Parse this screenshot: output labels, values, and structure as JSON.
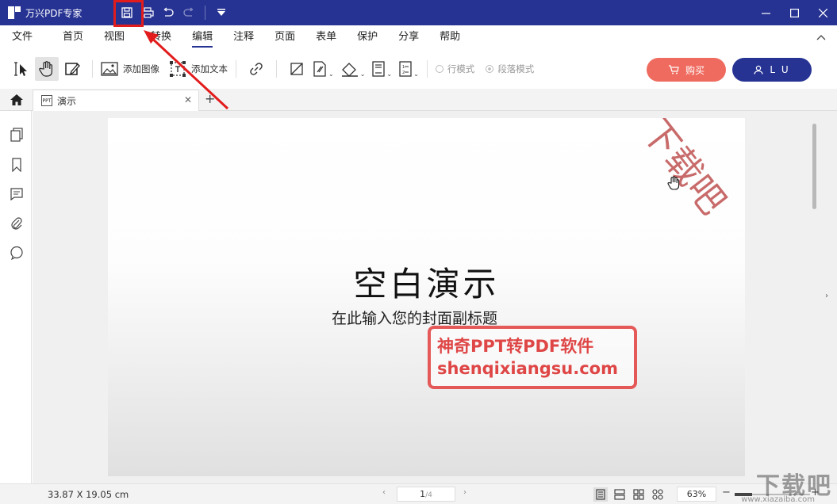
{
  "titlebar": {
    "app_title": "万兴PDF专家",
    "quick_access": [
      "save-icon",
      "print-icon",
      "undo-icon",
      "redo-icon",
      "customize-dropdown-icon"
    ],
    "window_controls": [
      "minimize-icon",
      "maximize-icon",
      "close-icon"
    ]
  },
  "menu": {
    "items": [
      "文件",
      "首页",
      "视图",
      "转换",
      "编辑",
      "注释",
      "页面",
      "表单",
      "保护",
      "分享",
      "帮助"
    ],
    "active": "编辑"
  },
  "toolbar": {
    "add_image": "添加图像",
    "add_text": "添加文本",
    "line_mode": "行模式",
    "paragraph_mode": "段落模式",
    "buy": "购买",
    "user": "L U"
  },
  "tabs": {
    "doc_title": "演示",
    "doc_icon_text": "PPT"
  },
  "page": {
    "title": "空白演示",
    "subtitle": "在此输入您的封面副标题"
  },
  "watermarks": {
    "corner_text": "下载吧",
    "box_line1": "神奇PPT转PDF软件",
    "box_line2": "shenqixiangsu.com",
    "site_logo": "下载吧",
    "site_url": "www.xiazaiba.com"
  },
  "statusbar": {
    "dimensions": "33.87 X 19.05 cm",
    "current_page": "1",
    "total_pages": "/4",
    "zoom": "63%"
  },
  "colors": {
    "brand_navy": "#263393",
    "buy_coral": "#ef6b5f",
    "annotation_red": "#e21c1c"
  }
}
